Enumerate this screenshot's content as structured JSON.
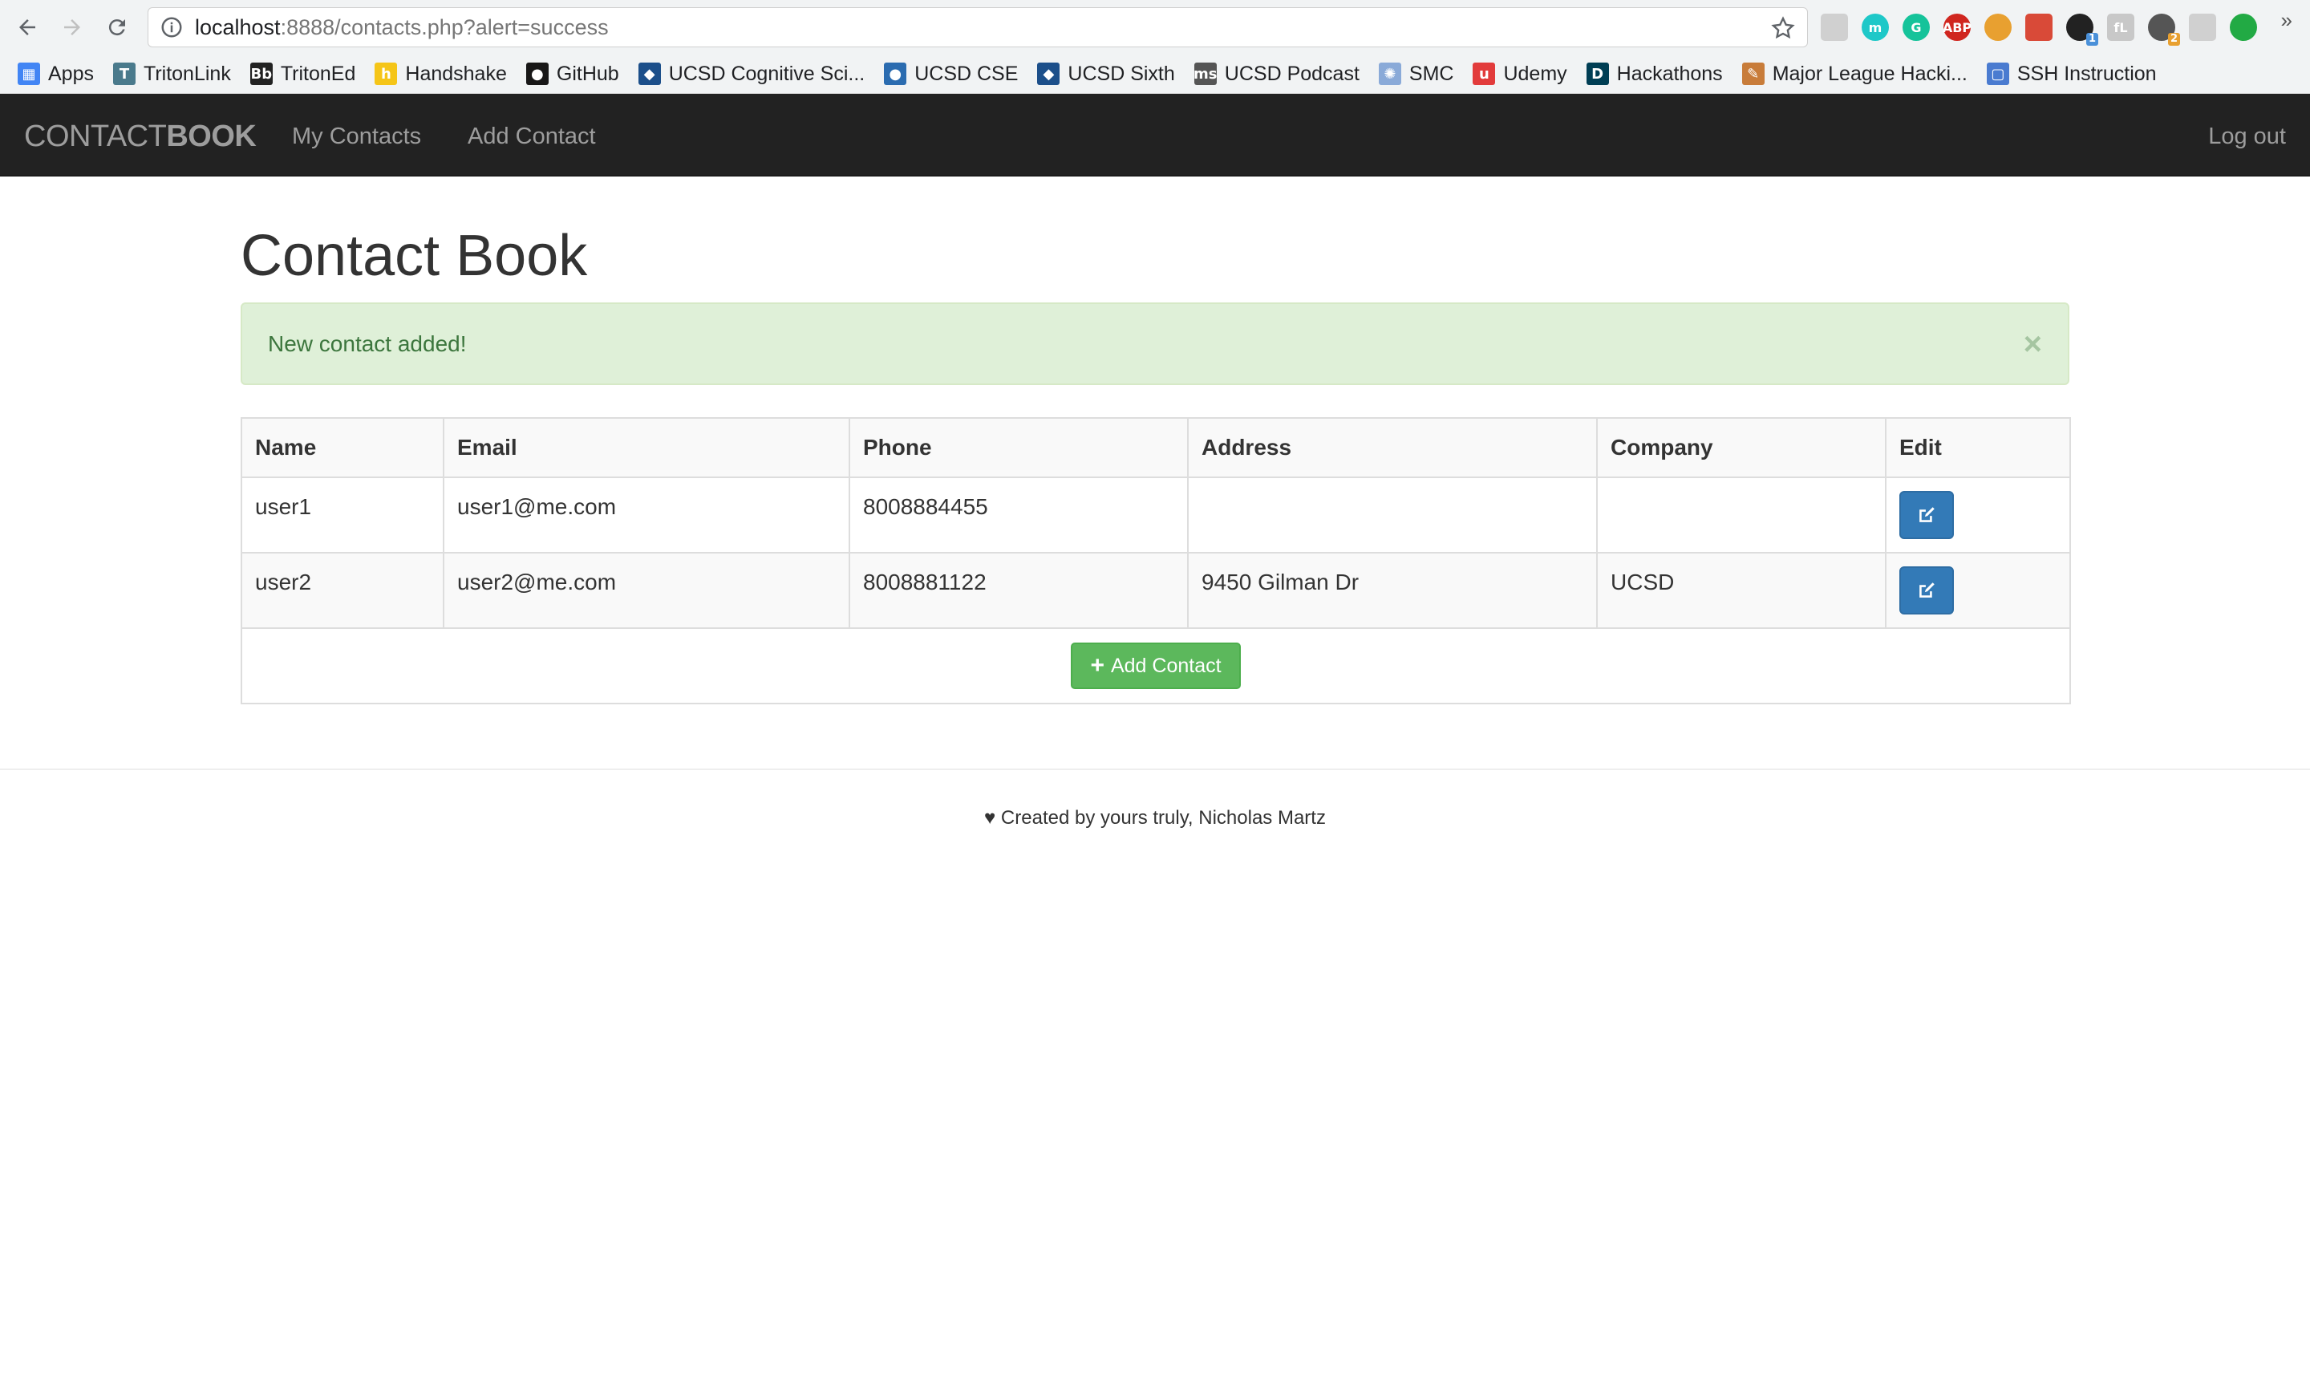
{
  "browser": {
    "url_host": "localhost",
    "url_path": ":8888/contacts.php?alert=success",
    "extensions": [
      {
        "name": "puzzle-ext-icon",
        "label": "",
        "color": "#d0d0d0"
      },
      {
        "name": "mercury-ext-icon",
        "label": "m",
        "color": "#1ec8c8"
      },
      {
        "name": "grammarly-ext-icon",
        "label": "G",
        "color": "#15c39a"
      },
      {
        "name": "adblock-ext-icon",
        "label": "ABP",
        "color": "#d0261f"
      },
      {
        "name": "rainbow-ext-icon",
        "label": "",
        "color": "#e8a030"
      },
      {
        "name": "book-ext-icon",
        "label": "",
        "color": "#d94a38"
      },
      {
        "name": "evernote-ext-icon",
        "label": "",
        "color": "#222222",
        "badge": "1",
        "badge_color": "#4a90d9"
      },
      {
        "name": "font-ext-icon",
        "label": "fL",
        "color": "#c8c8c8"
      },
      {
        "name": "draw-ext-icon",
        "label": "",
        "color": "#555555",
        "badge": "2",
        "badge_color": "#e8a030"
      },
      {
        "name": "refresh-ext-icon",
        "label": "",
        "color": "#d0d0d0"
      },
      {
        "name": "upload-ext-icon",
        "label": "",
        "color": "#22aa44"
      }
    ]
  },
  "bookmarks": [
    {
      "label": "Apps",
      "icon": "apps-grid-icon",
      "color": "#4285f4",
      "glyph": "▦"
    },
    {
      "label": "TritonLink",
      "icon": "tritonlink-icon",
      "color": "#4a7a8c",
      "glyph": "T"
    },
    {
      "label": "TritonEd",
      "icon": "blackboard-icon",
      "color": "#222222",
      "glyph": "Bb"
    },
    {
      "label": "Handshake",
      "icon": "handshake-icon",
      "color": "#f5c518",
      "glyph": "h"
    },
    {
      "label": "GitHub",
      "icon": "github-icon",
      "color": "#181717",
      "glyph": "●"
    },
    {
      "label": "UCSD Cognitive Sci...",
      "icon": "ucsd-cogsci-icon",
      "color": "#1c4f8a",
      "glyph": "◆"
    },
    {
      "label": "UCSD CSE",
      "icon": "ucsd-cse-icon",
      "color": "#2b6cb0",
      "glyph": "●"
    },
    {
      "label": "UCSD Sixth",
      "icon": "ucsd-sixth-icon",
      "color": "#1c4f8a",
      "glyph": "◆"
    },
    {
      "label": "UCSD Podcast",
      "icon": "podcast-icon",
      "color": "#555555",
      "glyph": "ms"
    },
    {
      "label": "SMC",
      "icon": "smc-icon",
      "color": "#8aaad8",
      "glyph": "✺"
    },
    {
      "label": "Udemy",
      "icon": "udemy-icon",
      "color": "#e23b3b",
      "glyph": "u"
    },
    {
      "label": "Hackathons",
      "icon": "devpost-icon",
      "color": "#003e54",
      "glyph": "D"
    },
    {
      "label": "Major League Hacki...",
      "icon": "mlh-icon",
      "color": "#c87c3a",
      "glyph": "✎"
    },
    {
      "label": "SSH Instruction",
      "icon": "ssh-doc-icon",
      "color": "#4a7bd0",
      "glyph": "▢"
    }
  ],
  "bookmarks_more": "»",
  "navbar": {
    "brand_light": "CONTACT",
    "brand_bold": "BOOK",
    "links": [
      "My Contacts",
      "Add Contact"
    ],
    "logout": "Log out"
  },
  "page": {
    "title": "Contact Book",
    "alert_message": "New contact added!",
    "alert_close": "×"
  },
  "table": {
    "headers": {
      "name": "Name",
      "email": "Email",
      "phone": "Phone",
      "address": "Address",
      "company": "Company",
      "edit": "Edit"
    },
    "rows": [
      {
        "name": "user1",
        "email": "user1@me.com",
        "phone": "8008884455",
        "address": "",
        "company": ""
      },
      {
        "name": "user2",
        "email": "user2@me.com",
        "phone": "8008881122",
        "address": "9450 Gilman Dr",
        "company": "UCSD"
      }
    ],
    "add_button": "Add Contact",
    "add_icon": "+"
  },
  "footer": {
    "text": "♥ Created by yours truly, Nicholas Martz"
  },
  "colors": {
    "navbar_bg": "#222222",
    "alert_bg": "#dff0d8",
    "alert_text": "#3c763d",
    "edit_button": "#337ab7",
    "add_button": "#5cb85c"
  }
}
